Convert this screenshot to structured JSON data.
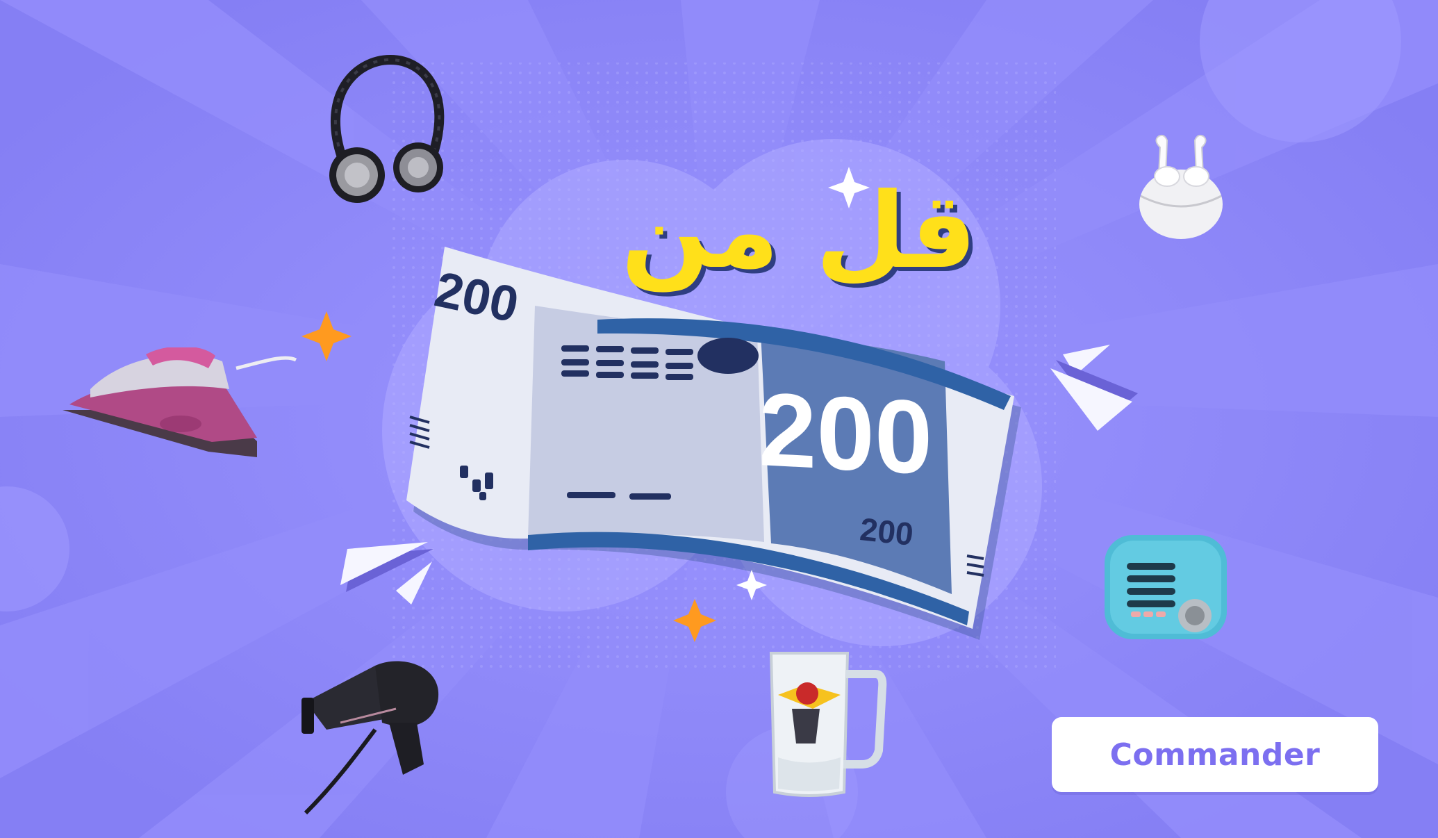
{
  "banner": {
    "headline": "قل من",
    "note": {
      "value": "200",
      "corner": "200",
      "small": "200"
    },
    "cta_label": "Commander",
    "colors": {
      "background": "#8B85F8",
      "accent": "#FFE01A",
      "cta_text": "#7C6FF0",
      "note_blue": "#4A6FB0"
    },
    "products": [
      {
        "icon": "headphones-icon"
      },
      {
        "icon": "earbuds-icon"
      },
      {
        "icon": "steam-iron-icon"
      },
      {
        "icon": "radio-speaker-icon"
      },
      {
        "icon": "hair-dryer-icon"
      },
      {
        "icon": "beer-mug-icon"
      }
    ]
  }
}
